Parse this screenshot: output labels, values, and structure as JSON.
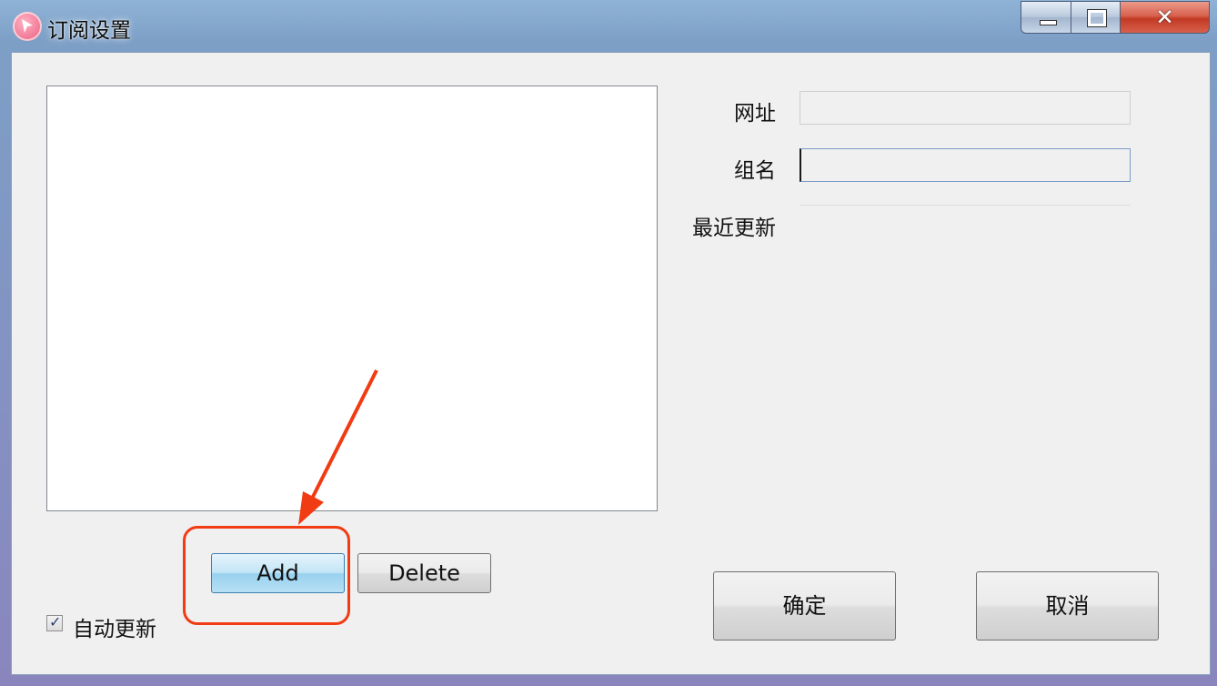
{
  "window": {
    "title": "订阅设置",
    "app_icon": "cursor-arrow-icon",
    "caption_buttons": {
      "minimize": "minimize-icon",
      "maximize": "maximize-icon",
      "close": "✕"
    }
  },
  "form": {
    "url_label": "网址",
    "url_value": "",
    "group_label": "组名",
    "group_value": "",
    "last_updated_label": "最近更新",
    "last_updated_value": ""
  },
  "list": {
    "items": []
  },
  "buttons": {
    "add": "Add",
    "delete": "Delete",
    "ok": "确定",
    "cancel": "取消"
  },
  "auto_update": {
    "label": "自动更新",
    "checked": true,
    "check_mark": "✓"
  },
  "annotation": {
    "color": "#f13b12"
  }
}
